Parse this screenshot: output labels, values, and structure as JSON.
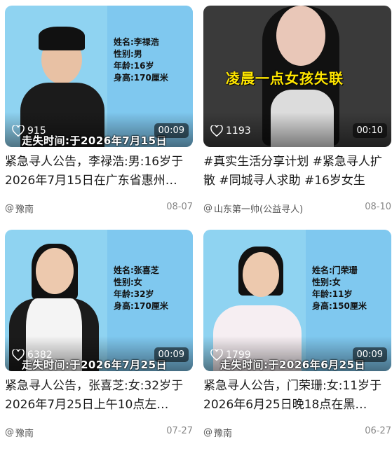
{
  "cards": [
    {
      "info": [
        "姓名:李禄浩",
        "性别:男",
        "年龄:16岁",
        "身高:170厘米"
      ],
      "missing": "走失时间:于2026年7月15日",
      "likes": "915",
      "duration": "00:09",
      "title": "紧急寻人公告，李禄浩:男:16岁于2026年7月15日在广东省惠州…",
      "author": "豫南",
      "date": "08-07"
    },
    {
      "caption": "凌晨一点女孩失联",
      "likes": "1193",
      "duration": "00:10",
      "title": "#真实生活分享计划 #紧急寻人扩散 #同城寻人求助 #16岁女生",
      "author": "山东第一帅(公益寻人)",
      "date": "08-10"
    },
    {
      "info": [
        "姓名:张喜芝",
        "性别:女",
        "年龄:32岁",
        "身高:170厘米"
      ],
      "missing": "走失时间:于2026年7月25日",
      "likes": "6382",
      "duration": "00:09",
      "title": "紧急寻人公告，张喜芝:女:32岁于2026年7月25日上午10点左…",
      "author": "豫南",
      "date": "07-27"
    },
    {
      "info": [
        "姓名:门荣珊",
        "性别:女",
        "年龄:11岁",
        "身高:150厘米"
      ],
      "missing": "走失时间:于2026年6月25日",
      "likes": "1799",
      "duration": "00:09",
      "title": "紧急寻人公告，门荣珊:女:11岁于2026年6月25日晚18点在黑…",
      "author": "豫南",
      "date": "06-27"
    }
  ],
  "icons": {
    "like": "heart-outline-icon",
    "author": "at-sign-icon"
  },
  "colors": {
    "panel": "#7fc8ef",
    "caption": "#ffe600"
  }
}
